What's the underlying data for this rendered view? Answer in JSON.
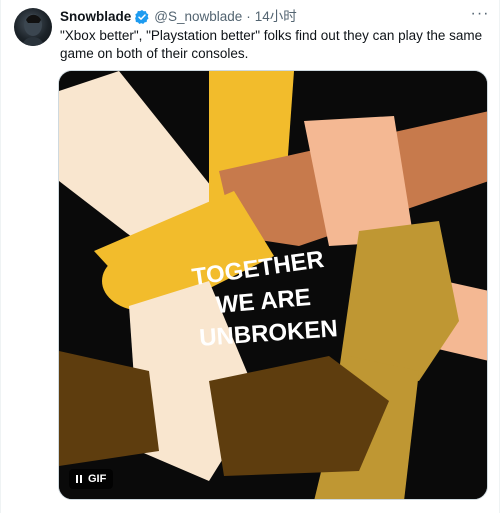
{
  "tweet": {
    "display_name": "Snowblade",
    "handle": "@S_nowblade",
    "separator": "·",
    "timestamp": "14小时",
    "more_glyph": "···",
    "text": "\"Xbox better\", \"Playstation better\" folks find out they can play the same game on both of their consoles.",
    "verified_color": "#1d9bf0"
  },
  "media": {
    "type": "gif",
    "art_text_line1": "TOGETHER",
    "art_text_line2": "WE ARE",
    "art_text_line3": "UNBROKEN",
    "badge_label": "GIF",
    "badge_icon": "pause-icon",
    "colors": {
      "background": "#0a0a0a",
      "yellow": "#f2bc2c",
      "cream": "#f9e6cf",
      "tan_brown": "#c77a4c",
      "peach": "#f4b893",
      "olive": "#bf9733",
      "dark_brown": "#5e3d0e"
    }
  }
}
